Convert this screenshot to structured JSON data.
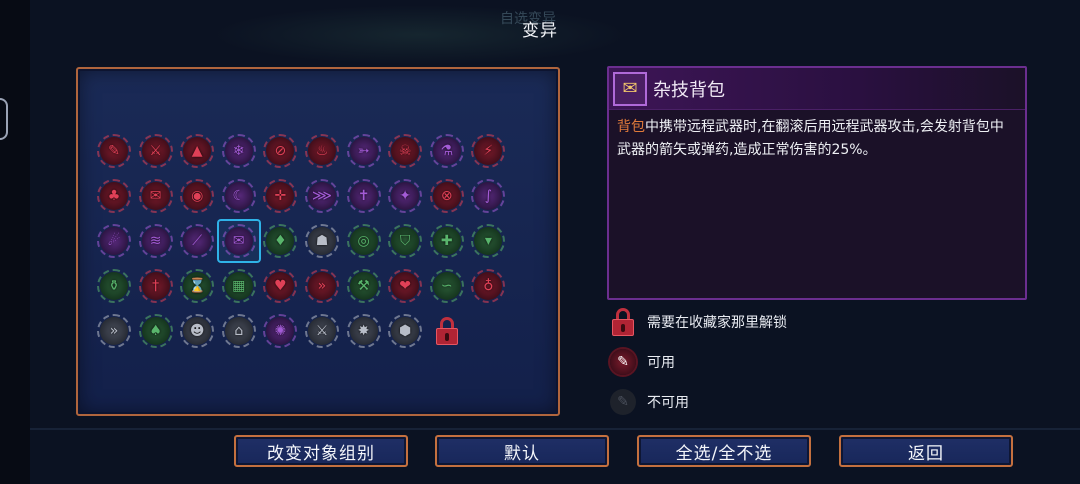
{
  "title": "变异",
  "background_ghost_text": "自选变异",
  "grid": {
    "rows": [
      [
        {
          "icon": "throwing-knife-icon",
          "glyph": "✎",
          "color": "red"
        },
        {
          "icon": "crossbow-icon",
          "glyph": "⚔",
          "color": "red"
        },
        {
          "icon": "tent-icon",
          "glyph": "▲",
          "color": "red"
        },
        {
          "icon": "frost-sword-icon",
          "glyph": "❄",
          "color": "purple"
        },
        {
          "icon": "no-symbol-icon",
          "glyph": "⊘",
          "color": "red"
        },
        {
          "icon": "potion-flask-icon",
          "glyph": "♨",
          "color": "red"
        },
        {
          "icon": "rifle-icon",
          "glyph": "➳",
          "color": "purple"
        },
        {
          "icon": "bloody-skull-icon",
          "glyph": "☠",
          "color": "red"
        },
        {
          "icon": "blue-potion-icon",
          "glyph": "⚗",
          "color": "purple"
        },
        {
          "icon": "lightning-bolt-icon",
          "glyph": "⚡",
          "color": "red"
        }
      ],
      [
        {
          "icon": "mushroom-icon",
          "glyph": "♣",
          "color": "red"
        },
        {
          "icon": "scroll-bag-icon",
          "glyph": "✉",
          "color": "red"
        },
        {
          "icon": "target-eye-icon",
          "glyph": "◉",
          "color": "red"
        },
        {
          "icon": "crescent-icon",
          "glyph": "☾",
          "color": "purple"
        },
        {
          "icon": "crosshair-icon",
          "glyph": "✛",
          "color": "red"
        },
        {
          "icon": "triple-arrow-icon",
          "glyph": "⋙",
          "color": "purple"
        },
        {
          "icon": "acrobat-figure-icon",
          "glyph": "✝",
          "color": "purple"
        },
        {
          "icon": "star-burst-icon",
          "glyph": "✦",
          "color": "purple"
        },
        {
          "icon": "crossed-circle-icon",
          "glyph": "⊗",
          "color": "red"
        },
        {
          "icon": "chain-hook-icon",
          "glyph": "∫",
          "color": "purple"
        }
      ],
      [
        {
          "icon": "feather-icon",
          "glyph": "☄",
          "color": "purple"
        },
        {
          "icon": "fish-gun-icon",
          "glyph": "≋",
          "color": "purple"
        },
        {
          "icon": "slash-blade-icon",
          "glyph": "⟋",
          "color": "purple"
        },
        {
          "icon": "acrobat-backpack-icon",
          "glyph": "✉",
          "color": "purple",
          "selected": true
        },
        {
          "icon": "poison-drop-icon",
          "glyph": "♦",
          "color": "green"
        },
        {
          "icon": "demon-mask-icon",
          "glyph": "☗",
          "color": "grey"
        },
        {
          "icon": "shield-ring-icon",
          "glyph": "◎",
          "color": "green"
        },
        {
          "icon": "orange-shield-icon",
          "glyph": "⛉",
          "color": "green"
        },
        {
          "icon": "green-cross-shield-icon",
          "glyph": "✚",
          "color": "green"
        },
        {
          "icon": "vampire-fangs-icon",
          "glyph": "▾",
          "color": "green"
        }
      ],
      [
        {
          "icon": "green-potion-icon",
          "glyph": "⚱",
          "color": "green"
        },
        {
          "icon": "sword-hand-icon",
          "glyph": "†",
          "color": "red"
        },
        {
          "icon": "hourglass-icon",
          "glyph": "⌛",
          "color": "green"
        },
        {
          "icon": "blue-grid-icon",
          "glyph": "▦",
          "color": "green"
        },
        {
          "icon": "blood-drop-icon",
          "glyph": "♥",
          "color": "red"
        },
        {
          "icon": "double-chevron-icon",
          "glyph": "»",
          "color": "red"
        },
        {
          "icon": "hammer-shield-icon",
          "glyph": "⚒",
          "color": "green"
        },
        {
          "icon": "heart-flame-icon",
          "glyph": "❤",
          "color": "red"
        },
        {
          "icon": "snake-icon",
          "glyph": "∽",
          "color": "green"
        },
        {
          "icon": "orange-flask-icon",
          "glyph": "♁",
          "color": "red"
        }
      ],
      [
        {
          "icon": "speed-arrows-icon",
          "glyph": "»",
          "color": "grey"
        },
        {
          "icon": "leaf-hood-icon",
          "glyph": "♠",
          "color": "green"
        },
        {
          "icon": "skull-face-icon",
          "glyph": "☻",
          "color": "grey"
        },
        {
          "icon": "cyan-gate-icon",
          "glyph": "⌂",
          "color": "grey"
        },
        {
          "icon": "pink-orb-icon",
          "glyph": "✺",
          "color": "purple"
        },
        {
          "icon": "axe-icon",
          "glyph": "⚔",
          "color": "grey"
        },
        {
          "icon": "golden-star-icon",
          "glyph": "✸",
          "color": "grey"
        },
        {
          "icon": "barrel-icon",
          "glyph": "⬢",
          "color": "grey"
        },
        {
          "icon": "lock-icon",
          "glyph": "",
          "color": "lock"
        }
      ]
    ]
  },
  "detail": {
    "name": "杂技背包",
    "icon": "acrobat-backpack-icon",
    "icon_glyph": "✉",
    "desc_highlight": "背包",
    "desc_rest": "中携带远程武器时,在翻滚后用远程武器攻击,会发射背包中武器的箭矢或弹药,造成正常伤害的25%。"
  },
  "legend": {
    "locked": "需要在收藏家那里解锁",
    "available": "可用",
    "unavailable": "不可用"
  },
  "buttons": {
    "change_group": "改变对象组别",
    "default": "默认",
    "select_all": "全选/全不选",
    "back": "返回"
  },
  "colors": {
    "panel_border": "#b0653d",
    "panel_fill": "#1a2a56",
    "detail_border": "#6b2e8f",
    "selection": "#2fb3e8",
    "highlight_text": "#e07a3a",
    "mutation_red": "#e04057",
    "mutation_purple": "#a35bd6",
    "mutation_green": "#59b56c"
  }
}
